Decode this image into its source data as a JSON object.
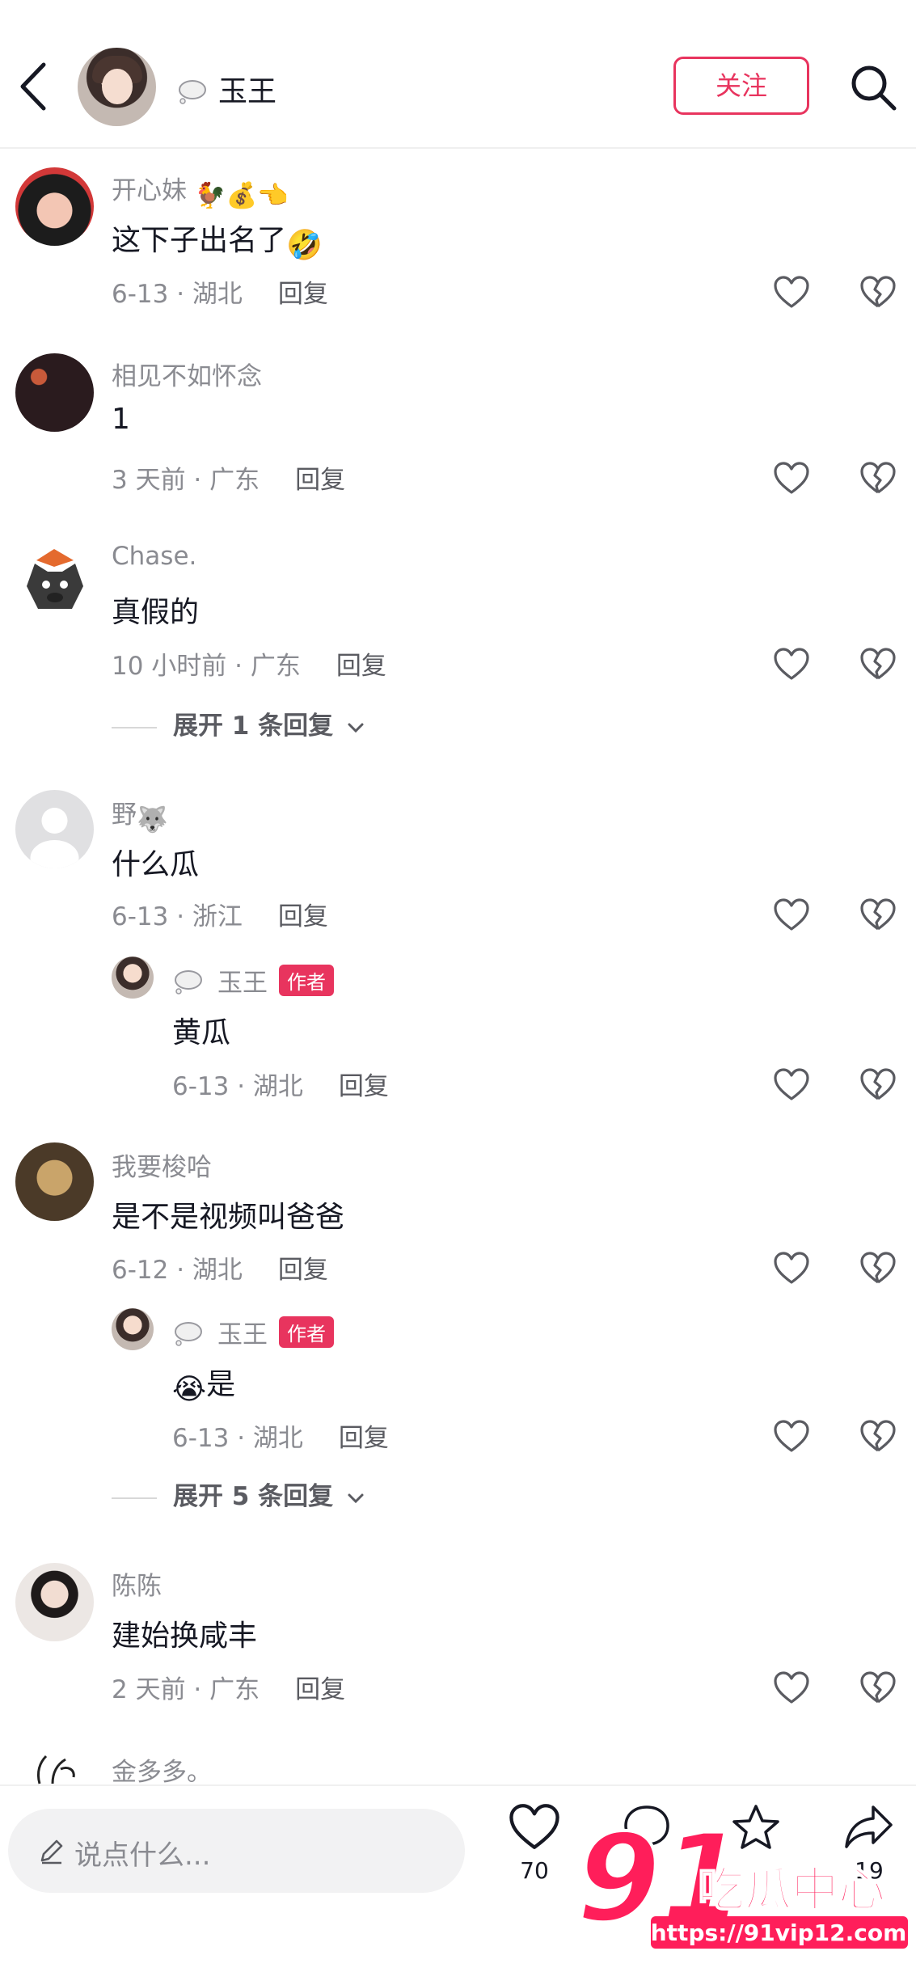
{
  "header": {
    "name": "玉王",
    "follow_label": "关注"
  },
  "comments": [
    {
      "user": "开心妹",
      "text": "这下子出名了",
      "date": "6-13 · 湖北",
      "reply_label": "回复"
    },
    {
      "user": "相见不如怀念",
      "text": "1",
      "date": "3 天前 · 广东",
      "reply_label": "回复"
    },
    {
      "user": "Chase.",
      "text": "真假的",
      "date": "10 小时前 · 广东",
      "reply_label": "回复",
      "expand_label": "展开 1 条回复"
    },
    {
      "user": "野",
      "text": "什么瓜",
      "date": "6-13 · 浙江",
      "reply_label": "回复",
      "author_reply": {
        "user": "玉王",
        "badge": "作者",
        "text": "黄瓜",
        "date": "6-13 · 湖北",
        "reply_label": "回复"
      }
    },
    {
      "user": "我要梭哈",
      "text": "是不是视频叫爸爸",
      "date": "6-12 · 湖北",
      "reply_label": "回复",
      "author_reply": {
        "user": "玉王",
        "badge": "作者",
        "text": "是",
        "date": "6-13 · 湖北",
        "reply_label": "回复"
      },
      "expand_label": "展开 5 条回复"
    },
    {
      "user": "陈陈",
      "text": "建始换咸丰",
      "date": "2 天前 · 广东",
      "reply_label": "回复"
    },
    {
      "user": "金多多。"
    }
  ],
  "bottom": {
    "input_placeholder": "说点什么...",
    "like_count": "70",
    "share_count": "19"
  },
  "watermark": {
    "brand": "91吃瓜中心",
    "url": "https://91vip12.com"
  },
  "colors": {
    "accent": "#e8345e",
    "secondary_text": "#8a8b91"
  }
}
